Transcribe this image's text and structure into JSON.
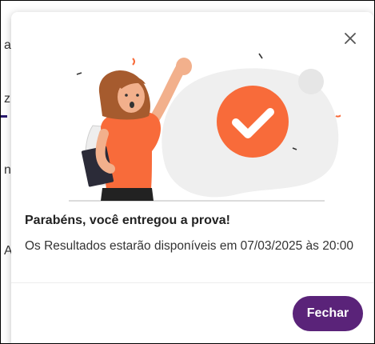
{
  "background": {
    "fragments": [
      "a",
      "z",
      "n",
      "A"
    ]
  },
  "dialog": {
    "title": "Parabéns, você entregou a prova!",
    "message": "Os Resultados estarão disponíveis em 07/03/2025 às 20:00",
    "close_icon": "close-icon",
    "button_label": "Fechar"
  },
  "colors": {
    "accent_purple": "#5a2379",
    "accent_orange": "#f86b3a",
    "blob_gray": "#efefef"
  }
}
